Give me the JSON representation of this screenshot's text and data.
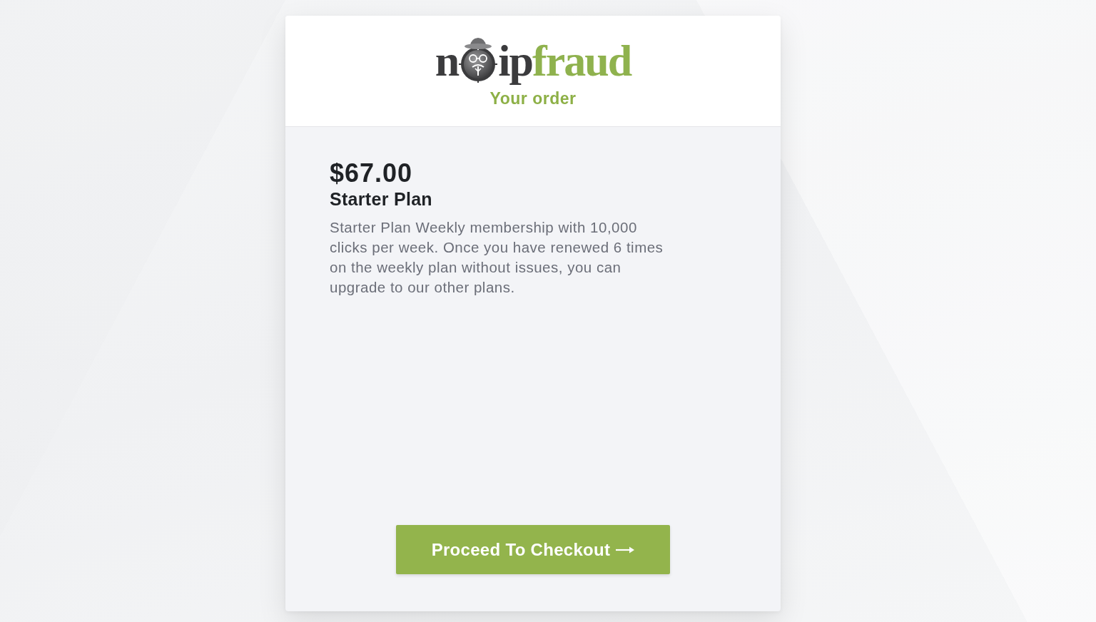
{
  "logo": {
    "before_emblem": "n",
    "after_emblem": "ip",
    "accent": "fraud"
  },
  "header": {
    "title": "Your order"
  },
  "order": {
    "price": "$67.00",
    "plan": "Starter Plan",
    "description": "Starter Plan Weekly membership with 10,000 clicks per week. Once you have renewed 6 times on the weekly plan without issues, you can upgrade to our other plans."
  },
  "checkout_button": {
    "label": "Proceed To Checkout"
  }
}
